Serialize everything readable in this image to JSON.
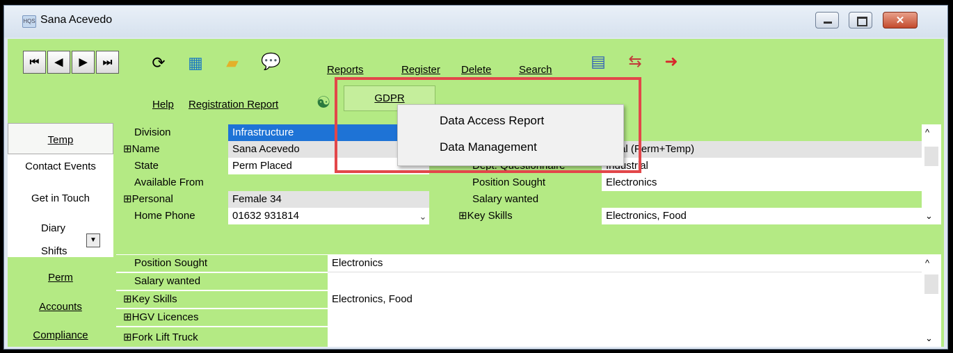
{
  "window": {
    "title": "Sana Acevedo",
    "app_icon": "hqs-app-icon"
  },
  "toolbar": {
    "nav": [
      "⏮",
      "◀",
      "▶",
      "⏭"
    ],
    "links": {
      "reports": "Reports",
      "register": "Register",
      "delete": "Delete",
      "search": "Search",
      "help": "Help",
      "registration_report": "Registration Report",
      "gdpr": "GDPR"
    }
  },
  "gdpr_menu": {
    "items": [
      "Data Access Report",
      "Data Management"
    ]
  },
  "side_tabs": {
    "temp": "Temp",
    "contact_events": "Contact Events",
    "get_in_touch": "Get in Touch",
    "diary": "Diary",
    "shifts": "Shifts",
    "perm": "Perm",
    "accounts": "Accounts",
    "compliance": "Compliance"
  },
  "top_left_fields": [
    {
      "label": "Division",
      "value": "Infrastructure"
    },
    {
      "label": "⊞Name",
      "value": "Sana Acevedo"
    },
    {
      "label": "State",
      "value": "Perm Placed"
    },
    {
      "label": "Available From",
      "value": ""
    },
    {
      "label": "⊞Personal",
      "value": "Female 34"
    },
    {
      "label": "Home Phone",
      "value": "01632 931814"
    }
  ],
  "top_right_fields": [
    {
      "label": "",
      "value": ""
    },
    {
      "label": "",
      "value": "strial (Perm+Temp)"
    },
    {
      "label": "Dept. Questionnaire",
      "value": "Industrial"
    },
    {
      "label": "Position Sought",
      "value": "Electronics"
    },
    {
      "label": "Salary wanted",
      "value": ""
    },
    {
      "label": "⊞Key Skills",
      "value": "Electronics, Food"
    }
  ],
  "bottom_fields": [
    {
      "label": "Position Sought",
      "value": "Electronics"
    },
    {
      "label": "Salary wanted",
      "value": ""
    },
    {
      "label": "⊞Key Skills",
      "value": "Electronics, Food"
    },
    {
      "label": "⊞HGV Licences",
      "value": ""
    },
    {
      "label": "⊞Fork Lift Truck",
      "value": ""
    }
  ],
  "colors": {
    "panel_green": "#b4ea84",
    "selection_blue": "#1e73d6",
    "highlight_red": "#e2474a"
  }
}
